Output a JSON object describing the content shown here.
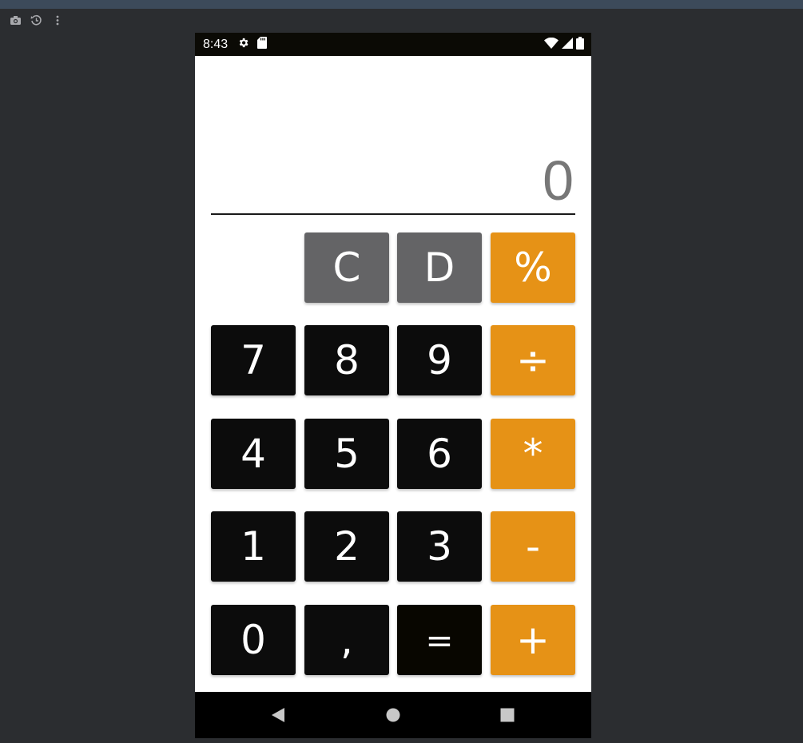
{
  "status_bar": {
    "time": "8:43"
  },
  "display": {
    "value": "0"
  },
  "keys": {
    "clear": "C",
    "delete": "D",
    "percent": "%",
    "seven": "7",
    "eight": "8",
    "nine": "9",
    "divide": "÷",
    "four": "4",
    "five": "5",
    "six": "6",
    "multiply": "*",
    "one": "1",
    "two": "2",
    "three": "3",
    "minus": "-",
    "zero": "0",
    "comma": ",",
    "equals": "=",
    "plus": "+"
  },
  "colors": {
    "operator": "#e69216",
    "function": "#646466",
    "number": "#0c0c0c",
    "display_text": "#777777"
  }
}
